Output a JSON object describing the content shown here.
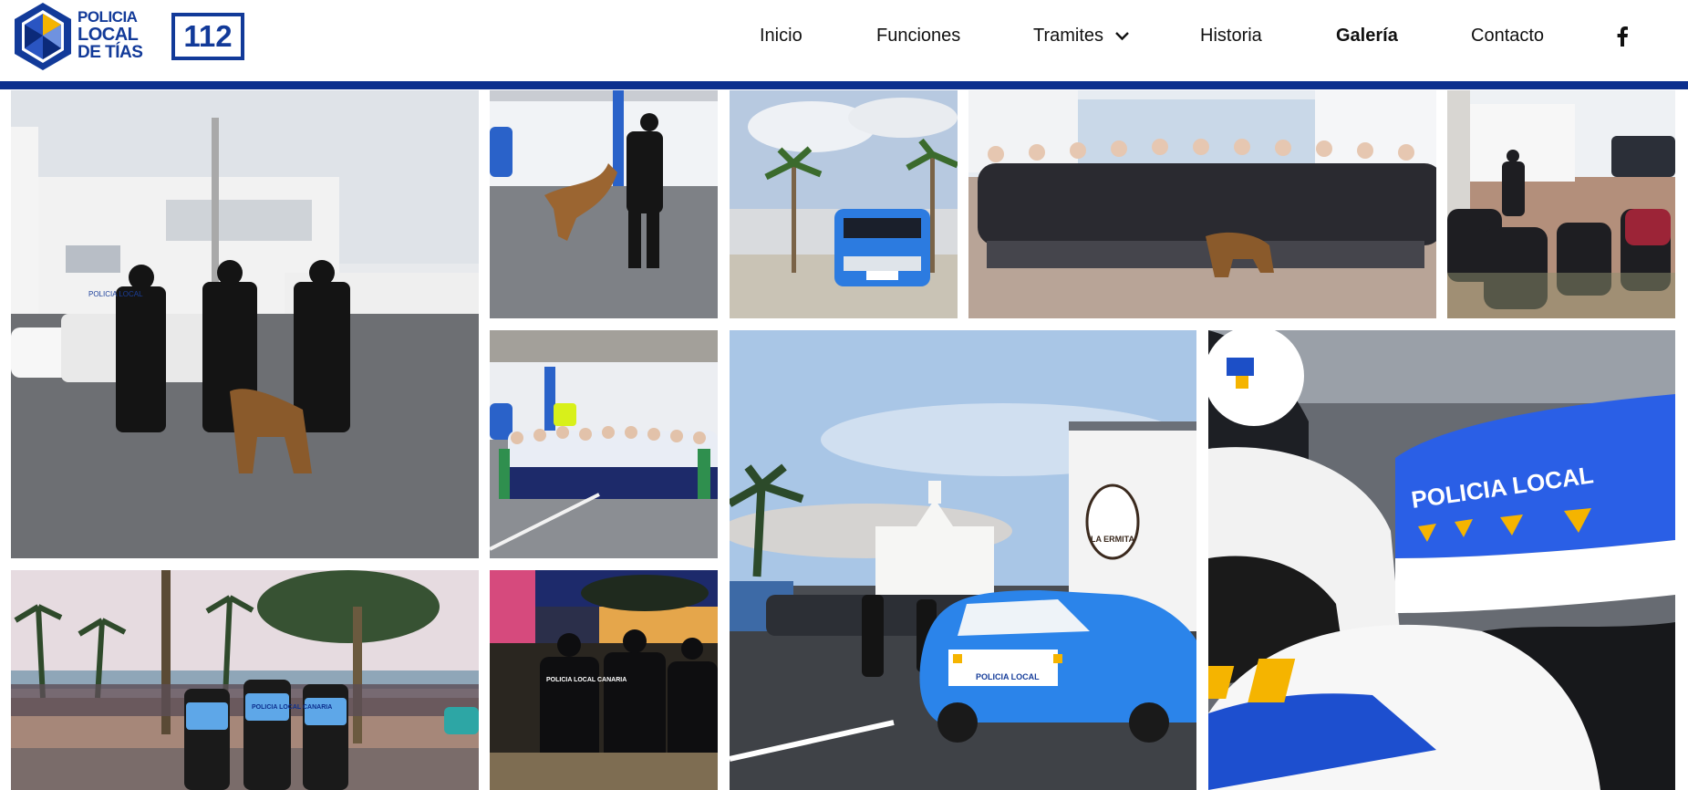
{
  "header": {
    "logo": {
      "line1": "POLICIA",
      "line2": "LOCAL",
      "line3": "DE TÍAS"
    },
    "emergency_number": "112",
    "nav": [
      "Inicio",
      "Funciones",
      "Tramites",
      "Historia",
      "Galería",
      "Contacto"
    ],
    "active_nav": "Galería",
    "social_icon": "facebook-icon"
  },
  "gallery": {
    "photos": [
      {
        "subject": "k9-unit-officers-at-station",
        "text_on_image": "POLICIA LOCAL"
      },
      {
        "subject": "k9-training-dog-jump"
      },
      {
        "subject": "patrol-car-palm-trees"
      },
      {
        "subject": "students-group-with-dog"
      },
      {
        "subject": "outdoor-talk-courtyard"
      },
      {
        "subject": "schoolchildren-with-k9"
      },
      {
        "subject": "patrol-car-ermita-event",
        "text_on_image": [
          "LA ERMITA",
          "POLICIA LOCAL"
        ]
      },
      {
        "subject": "motorcycle-livery-closeup",
        "text_on_image": "POLICIA LOCAL"
      },
      {
        "subject": "officers-promenade-backs",
        "text_on_image": "POLICIA LOCAL CANARIA"
      },
      {
        "subject": "night-event-officers",
        "text_on_image": "POLICIA LOCAL CANARIA"
      }
    ]
  },
  "colors": {
    "brand_blue": "#0c2f8e",
    "logo_blue": "#123a99",
    "accent_yellow": "#f5b400"
  }
}
